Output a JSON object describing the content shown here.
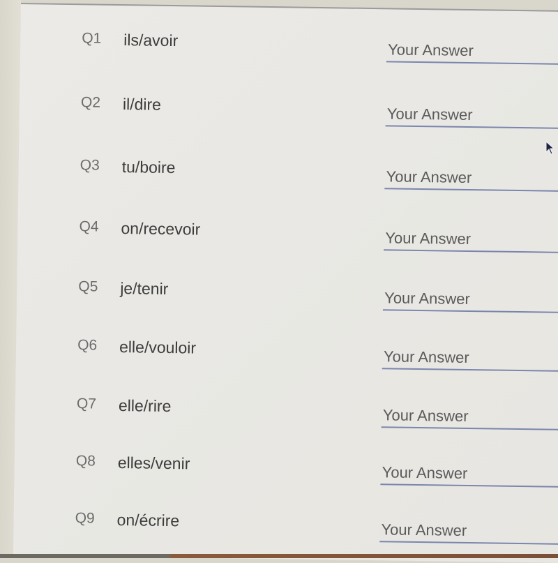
{
  "questions": [
    {
      "number": "Q1",
      "prompt": "ils/avoir",
      "answer_value": "",
      "answer_placeholder": "Your Answer"
    },
    {
      "number": "Q2",
      "prompt": "il/dire",
      "answer_value": "",
      "answer_placeholder": "Your Answer"
    },
    {
      "number": "Q3",
      "prompt": "tu/boire",
      "answer_value": "",
      "answer_placeholder": "Your Answer"
    },
    {
      "number": "Q4",
      "prompt": "on/recevoir",
      "answer_value": "",
      "answer_placeholder": "Your Answer"
    },
    {
      "number": "Q5",
      "prompt": "je/tenir",
      "answer_value": "",
      "answer_placeholder": "Your Answer"
    },
    {
      "number": "Q6",
      "prompt": "elle/vouloir",
      "answer_value": "",
      "answer_placeholder": "Your Answer"
    },
    {
      "number": "Q7",
      "prompt": "elle/rire",
      "answer_value": "",
      "answer_placeholder": "Your Answer"
    },
    {
      "number": "Q8",
      "prompt": "elles/venir",
      "answer_value": "",
      "answer_placeholder": "Your Answer"
    },
    {
      "number": "Q9",
      "prompt": "on/écrire",
      "answer_value": "",
      "answer_placeholder": "Your Answer"
    }
  ],
  "cursor_icon": "mouse-pointer-icon"
}
